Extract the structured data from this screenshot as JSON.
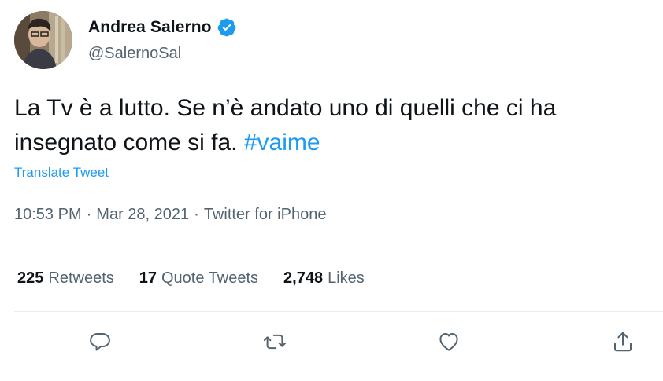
{
  "author": {
    "display_name": "Andrea Salerno",
    "handle": "@SalernoSal",
    "verified_icon": "verified-badge-icon"
  },
  "tweet": {
    "text": "La Tv è a lutto. Se n’è andato uno di quelli che ci ha insegnato come si fa. ",
    "hashtag": "#vaime",
    "translate_label": "Translate Tweet"
  },
  "meta": {
    "time": "10:53 PM",
    "separator": "·",
    "date": "Mar 28, 2021",
    "source": "Twitter for iPhone"
  },
  "stats": {
    "retweets_count": "225",
    "retweets_label": "Retweets",
    "quotes_count": "17",
    "quotes_label": "Quote Tweets",
    "likes_count": "2,748",
    "likes_label": "Likes"
  },
  "actions": {
    "reply_icon": "reply-icon",
    "retweet_icon": "retweet-icon",
    "like_icon": "like-icon",
    "share_icon": "share-icon"
  },
  "colors": {
    "accent": "#1d9bf0",
    "text_primary": "#0f1419",
    "text_secondary": "#536471",
    "divider": "#e6ecf0"
  }
}
